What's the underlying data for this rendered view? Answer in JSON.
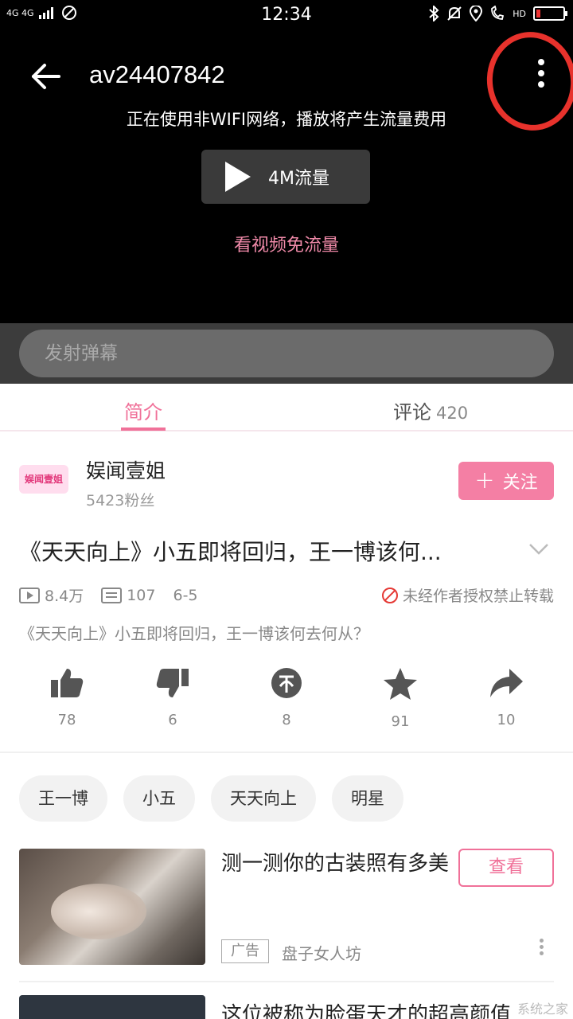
{
  "status_bar": {
    "network": "4G 4G",
    "time": "12:34",
    "hd": "HD",
    "battery_level": 0.15
  },
  "player": {
    "video_id": "av24407842",
    "notice": "正在使用非WIFI网络，播放将产生流量费用",
    "play_label": "4M流量",
    "free_link": "看视频免流量"
  },
  "danmaku": {
    "placeholder": "发射弹幕"
  },
  "tabs": {
    "intro": "简介",
    "comments": "评论",
    "comments_count": "420"
  },
  "uploader": {
    "logo_text": "娱闻壹姐",
    "name": "娱闻壹姐",
    "fans": "5423粉丝",
    "follow_label": "关注"
  },
  "video": {
    "title": "《天天向上》小五即将回归，王一博该何...",
    "views": "8.4万",
    "danmaku_count": "107",
    "date": "6-5",
    "copyright_notice": "未经作者授权禁止转载",
    "description": "《天天向上》小五即将回归，王一博该何去何从？"
  },
  "actions": [
    {
      "icon": "thumbs-up-icon",
      "count": "78"
    },
    {
      "icon": "thumbs-down-icon",
      "count": "6"
    },
    {
      "icon": "coin-icon",
      "count": "8"
    },
    {
      "icon": "star-icon",
      "count": "91"
    },
    {
      "icon": "share-icon",
      "count": "10"
    }
  ],
  "tags": [
    "王一博",
    "小五",
    "天天向上",
    "明星"
  ],
  "ad": {
    "thumb_caption": "盘子女人坊",
    "title": "测一测你的古装照有多美",
    "button": "查看",
    "badge": "广告",
    "source": "盘子女人坊"
  },
  "next_item": {
    "title": "这位被称为脸蛋天才的超高颜值"
  },
  "watermark": "系统之家",
  "colors": {
    "accent": "#f07199",
    "annotation": "#e8322c"
  }
}
